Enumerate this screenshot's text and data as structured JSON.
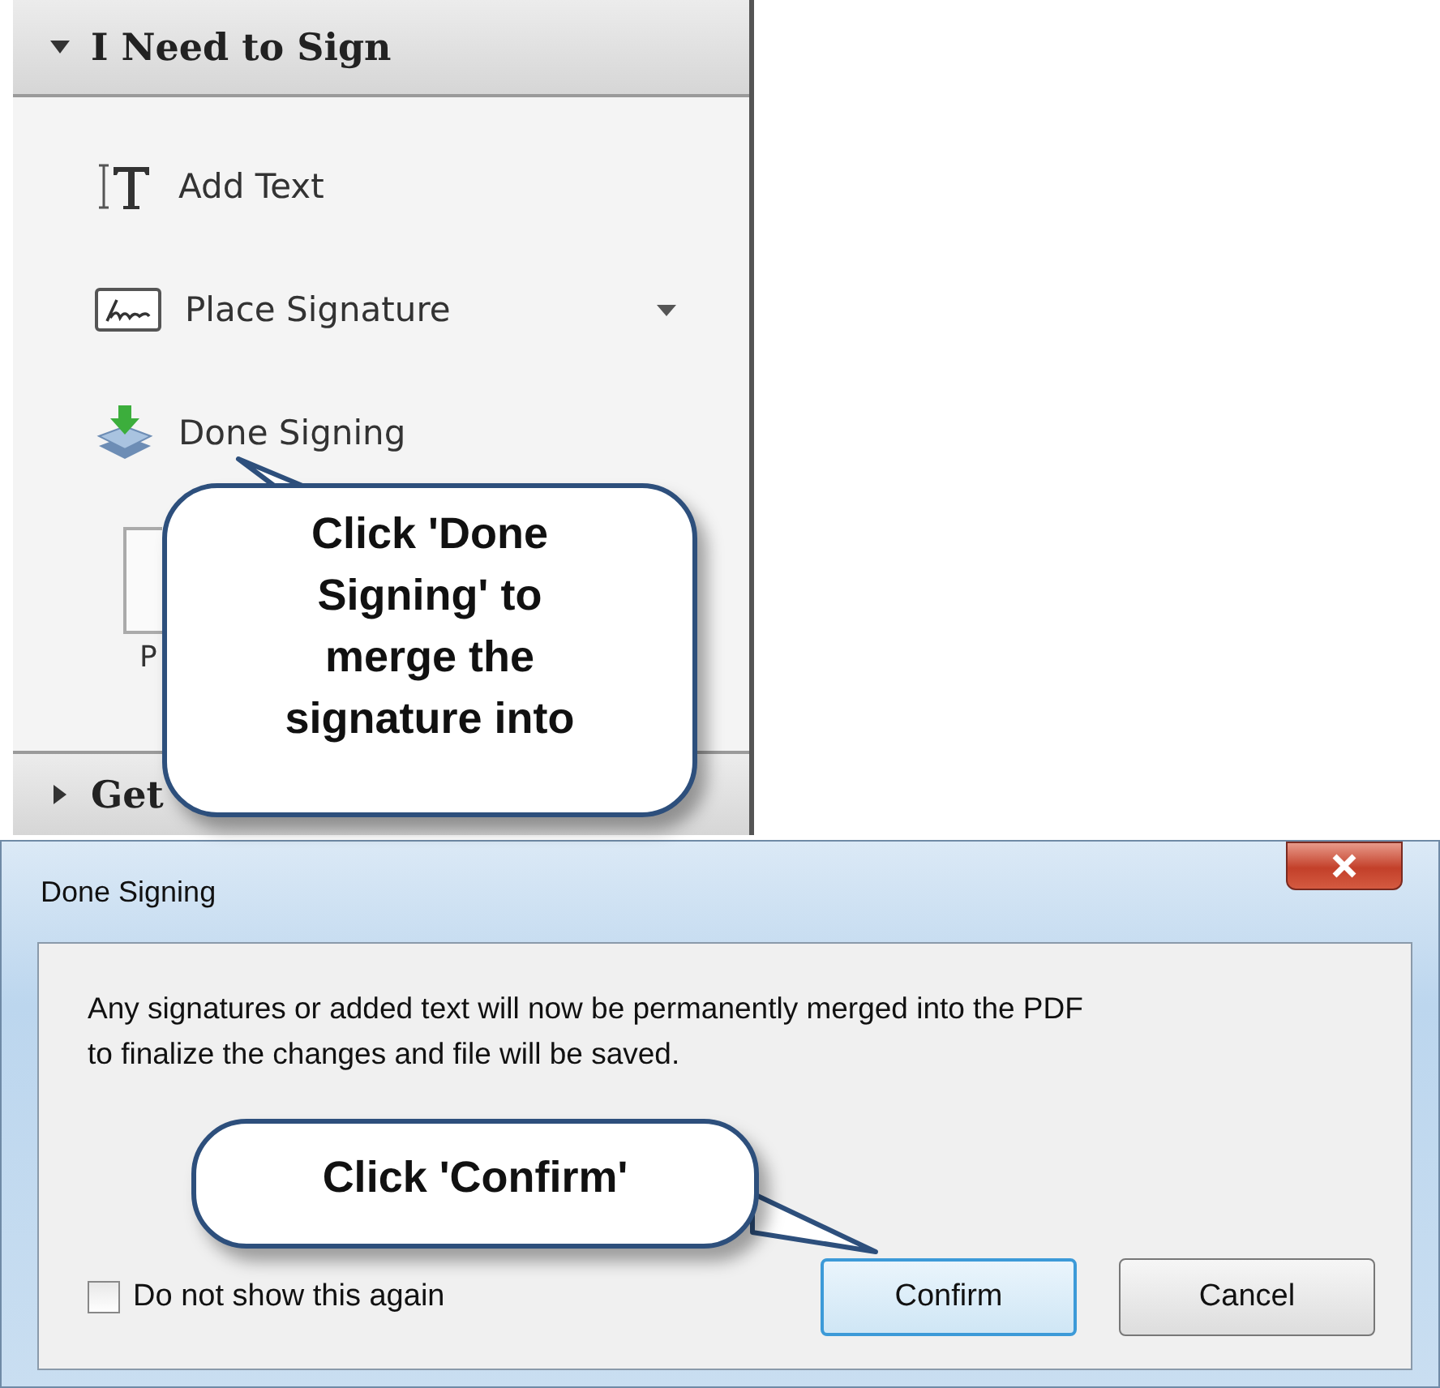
{
  "sidebar": {
    "sections": [
      {
        "title": "I Need to Sign",
        "expanded": true,
        "items": [
          {
            "label": "Add Text",
            "has_menu": false
          },
          {
            "label": "Place Signature",
            "has_menu": true
          },
          {
            "label": "Done Signing",
            "has_menu": false
          }
        ],
        "partial_label": "P"
      },
      {
        "title": "Get",
        "expanded": false
      }
    ]
  },
  "callouts": [
    {
      "text": "Click 'Done Signing' to merge the signature into"
    },
    {
      "text": "Click 'Confirm'"
    }
  ],
  "dialog": {
    "title": "Done Signing",
    "message_lines": [
      "Any signatures or added text will now be permanently merged into the PDF",
      "to finalize the changes and file will be saved."
    ],
    "checkbox": {
      "label": "Do not show this again",
      "checked": false
    },
    "buttons": [
      {
        "label": "Confirm",
        "default": true
      },
      {
        "label": "Cancel",
        "default": false
      }
    ]
  }
}
